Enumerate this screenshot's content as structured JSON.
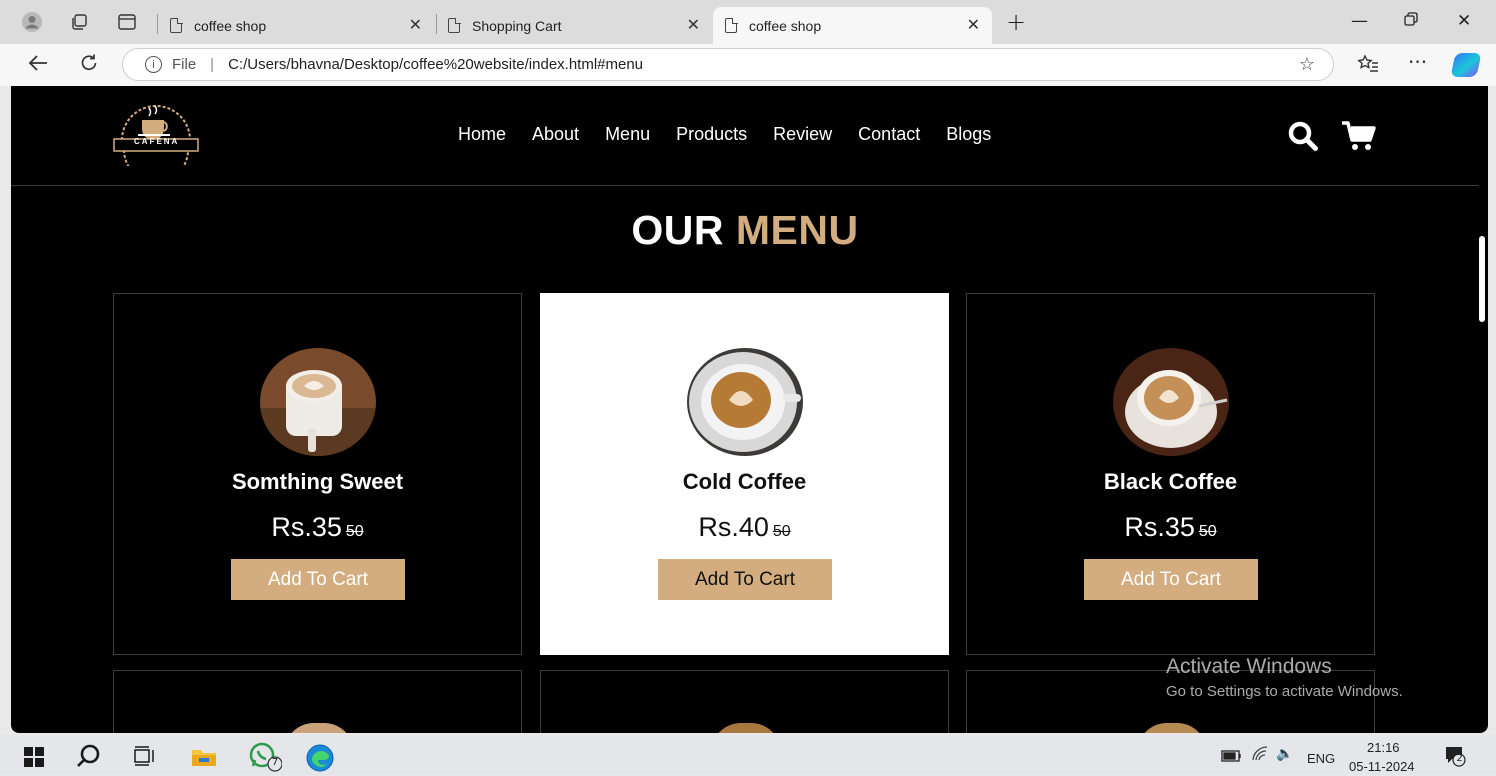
{
  "browser": {
    "tabs": [
      {
        "title": "coffee shop",
        "active": false
      },
      {
        "title": "Shopping Cart",
        "active": false
      },
      {
        "title": "coffee shop",
        "active": true
      }
    ],
    "new_tab": "+",
    "url_scheme": "File",
    "url": "C:/Users/bhavna/Desktop/coffee%20website/index.html#menu",
    "icons": [
      "profile-icon",
      "workspaces-icon",
      "tab-actions-icon",
      "back-icon",
      "refresh-icon",
      "info-icon",
      "favorite-star-icon",
      "favorites-icon",
      "more-icon",
      "copilot-icon",
      "minimize-icon",
      "restore-icon",
      "close-icon"
    ]
  },
  "site": {
    "logo_text": "CAFENA",
    "nav": [
      "Home",
      "About",
      "Menu",
      "Products",
      "Review",
      "Contact",
      "Blogs"
    ],
    "heading": {
      "part1": "OUR",
      "part2": "MENU"
    },
    "accent_color": "#d3ad7f",
    "menu_items": [
      {
        "name": "Somthing Sweet",
        "price": "Rs.35",
        "old_price": "50",
        "button": "Add To Cart",
        "highlighted": false
      },
      {
        "name": "Cold Coffee",
        "price": "Rs.40",
        "old_price": "50",
        "button": "Add To Cart",
        "highlighted": true
      },
      {
        "name": "Black Coffee",
        "price": "Rs.35",
        "old_price": "50",
        "button": "Add To Cart",
        "highlighted": false
      }
    ]
  },
  "watermark": {
    "line1": "Activate Windows",
    "line2": "Go to Settings to activate Windows."
  },
  "taskbar": {
    "whatsapp_badge": "7",
    "language": "ENG",
    "time": "21:16",
    "date": "05-11-2024",
    "notification_count": "2"
  }
}
